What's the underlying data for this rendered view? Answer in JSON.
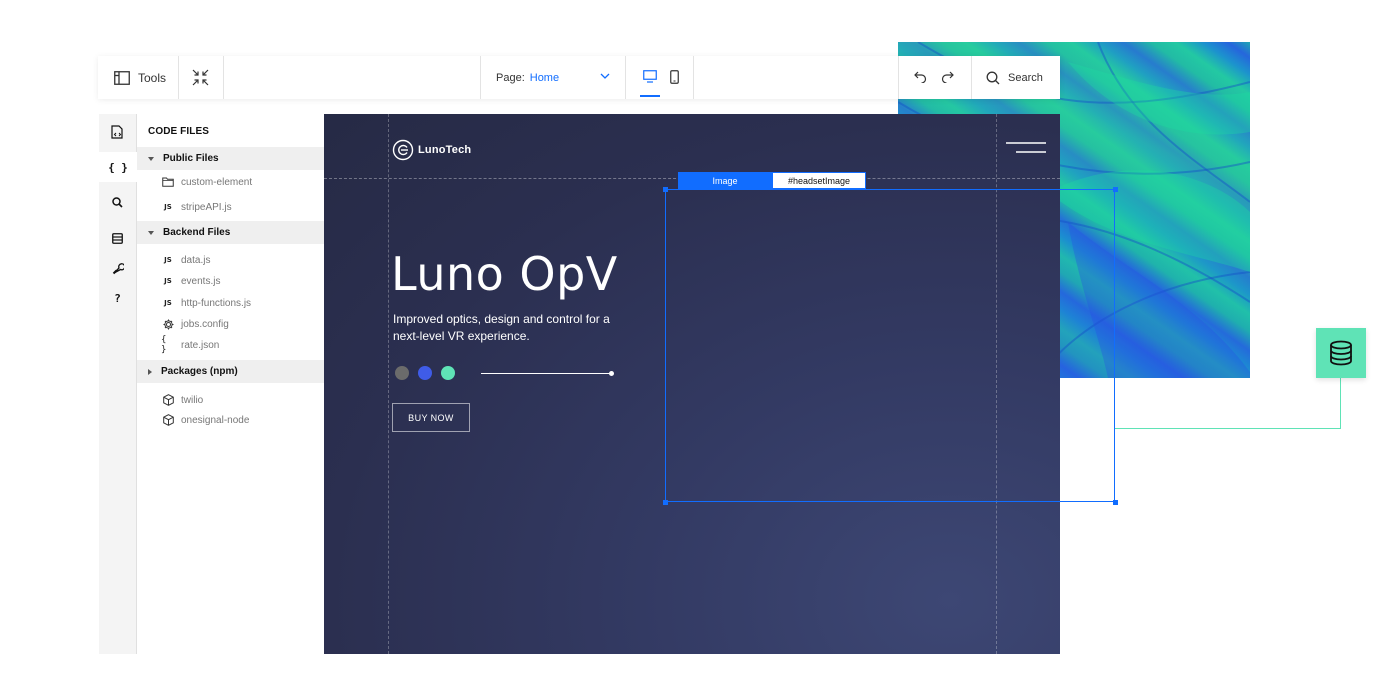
{
  "toolbar": {
    "tools_label": "Tools",
    "page_label": "Page:",
    "page_value": "Home",
    "search_label": "Search"
  },
  "code_files": {
    "title": "CODE FILES",
    "sections": [
      {
        "label": "Public Files",
        "expanded": true,
        "items": [
          {
            "icon": "folder-icon",
            "name": "custom-element"
          },
          {
            "icon": "js-file-icon",
            "name": "stripeAPI.js"
          }
        ]
      },
      {
        "label": "Backend Files",
        "expanded": true,
        "items": [
          {
            "icon": "js-file-icon",
            "name": "data.js"
          },
          {
            "icon": "js-file-icon",
            "name": "events.js"
          },
          {
            "icon": "js-file-icon",
            "name": "http-functions.js"
          },
          {
            "icon": "gear-icon",
            "name": "jobs.config"
          },
          {
            "icon": "json-braces-icon",
            "name": "rate.json"
          }
        ]
      },
      {
        "label": "Packages (npm)",
        "expanded": false,
        "items": [
          {
            "icon": "package-icon",
            "name": "twilio"
          },
          {
            "icon": "package-icon",
            "name": "onesignal-node"
          }
        ]
      }
    ]
  },
  "icons": {
    "js_glyph": "JS",
    "braces_glyph": "{ }",
    "rail_braces_glyph": "{ }",
    "rail_help_glyph": "?"
  },
  "site": {
    "logo_text": "LunoTech",
    "hero_title": "Luno OpV",
    "hero_subtitle": "Improved optics, design and control for a next-level VR experience.",
    "buy_button": "BUY NOW",
    "color_dots": [
      "#6b6b6b",
      "#3f5ce8",
      "#5fe3b6"
    ]
  },
  "selection": {
    "type_label": "Image",
    "element_id": "#headsetImage"
  },
  "colors": {
    "accent": "#116dff",
    "database": "#5fe3b6"
  }
}
